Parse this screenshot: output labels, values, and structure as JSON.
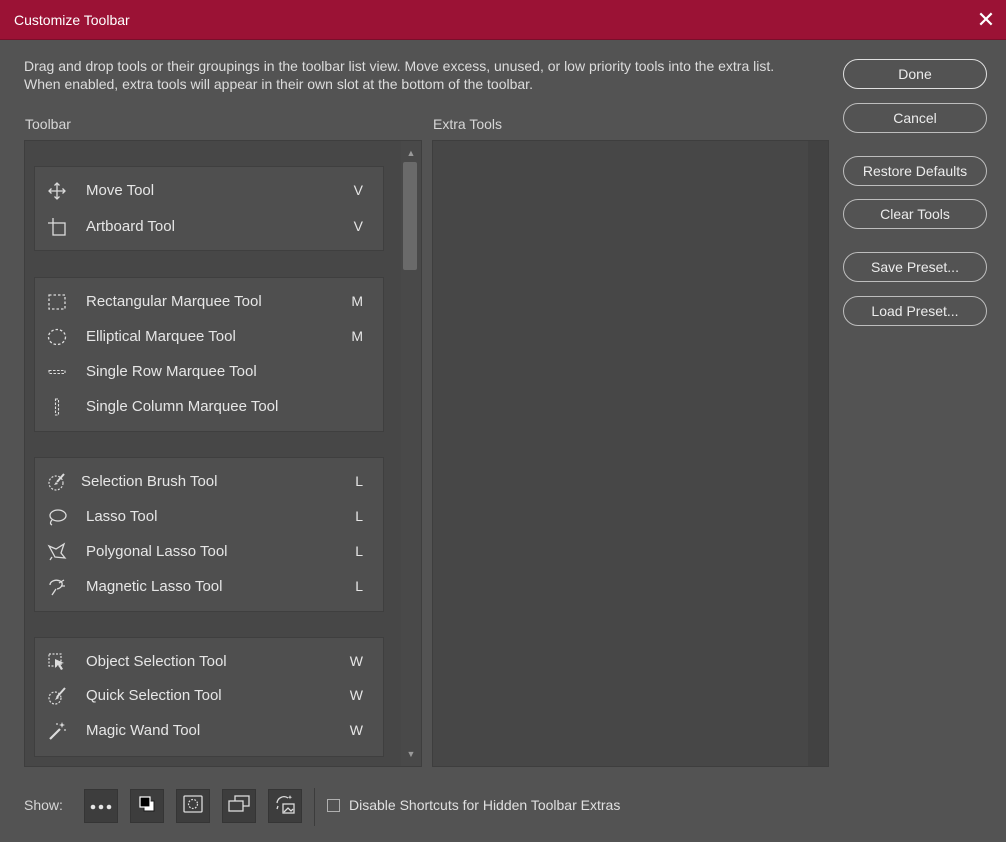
{
  "window": {
    "title": "Customize Toolbar",
    "close_glyph": "✕"
  },
  "description": "Drag and drop tools or their groupings in the toolbar list view. Move excess, unused, or low priority tools into the extra list. When enabled, extra tools will appear in their own slot at the bottom of the toolbar.",
  "toolbar_label": "Toolbar",
  "extra_label": "Extra Tools",
  "groups": [
    {
      "tools": [
        {
          "name": "Move Tool",
          "key": "V",
          "icon": "move-icon"
        },
        {
          "name": "Artboard Tool",
          "key": "V",
          "icon": "artboard-icon"
        }
      ]
    },
    {
      "tools": [
        {
          "name": "Rectangular Marquee Tool",
          "key": "M",
          "icon": "rect-marquee-icon"
        },
        {
          "name": "Elliptical Marquee Tool",
          "key": "M",
          "icon": "ellipse-marquee-icon"
        },
        {
          "name": "Single Row Marquee Tool",
          "key": "",
          "icon": "row-marquee-icon"
        },
        {
          "name": "Single Column Marquee Tool",
          "key": "",
          "icon": "column-marquee-icon"
        }
      ]
    },
    {
      "tools": [
        {
          "name": "Selection Brush Tool",
          "key": "L",
          "icon": "selection-brush-icon"
        },
        {
          "name": "Lasso Tool",
          "key": "L",
          "icon": "lasso-icon"
        },
        {
          "name": "Polygonal Lasso Tool",
          "key": "L",
          "icon": "polygonal-lasso-icon"
        },
        {
          "name": "Magnetic Lasso Tool",
          "key": "L",
          "icon": "magnetic-lasso-icon"
        }
      ]
    },
    {
      "tools": [
        {
          "name": "Object Selection Tool",
          "key": "W",
          "icon": "object-selection-icon"
        },
        {
          "name": "Quick Selection Tool",
          "key": "W",
          "icon": "quick-selection-icon"
        },
        {
          "name": "Magic Wand Tool",
          "key": "W",
          "icon": "magic-wand-icon"
        }
      ]
    }
  ],
  "buttons": {
    "done": "Done",
    "cancel": "Cancel",
    "restore_defaults": "Restore Defaults",
    "clear_tools": "Clear Tools",
    "save_preset": "Save Preset...",
    "load_preset": "Load Preset..."
  },
  "show": {
    "label": "Show:",
    "toggles": [
      "more-icon",
      "color-swatch-icon",
      "quick-mask-icon",
      "screen-mode-icon",
      "generative-fill-icon"
    ]
  },
  "disable_shortcuts": {
    "label": "Disable Shortcuts for Hidden Toolbar Extras",
    "checked": false
  }
}
